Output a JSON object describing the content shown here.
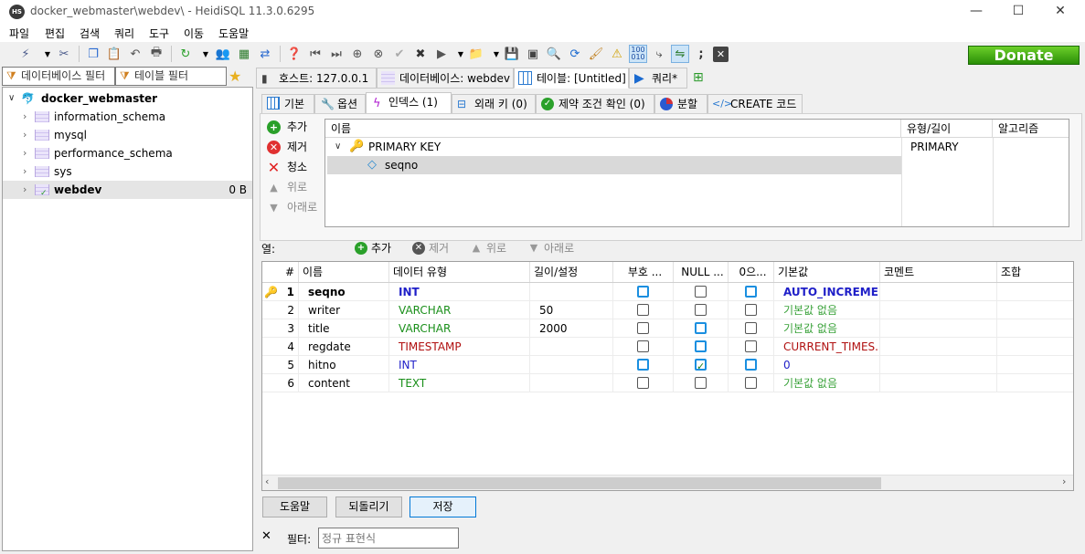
{
  "window": {
    "title": "docker_webmaster\\webdev\\ - HeidiSQL 11.3.0.6295",
    "app_icon_text": "HS",
    "controls": {
      "minimize": "—",
      "maximize": "☐",
      "close": "✕"
    }
  },
  "menu": [
    "파일",
    "편집",
    "검색",
    "쿼리",
    "도구",
    "이동",
    "도움말"
  ],
  "donate_label": "Donate",
  "filters": {
    "database": "데이터베이스 필터",
    "table": "테이블 필터"
  },
  "tree": {
    "root": "docker_webmaster",
    "items": [
      {
        "name": "information_schema",
        "size": ""
      },
      {
        "name": "mysql",
        "size": ""
      },
      {
        "name": "performance_schema",
        "size": ""
      },
      {
        "name": "sys",
        "size": ""
      },
      {
        "name": "webdev",
        "size": "0 B"
      }
    ]
  },
  "main_tabs": [
    {
      "label": "호스트: 127.0.0.1"
    },
    {
      "label": "데이터베이스: webdev"
    },
    {
      "label": "테이블: [Untitled]"
    },
    {
      "label": "쿼리*"
    }
  ],
  "sub_tabs": [
    {
      "label": "기본"
    },
    {
      "label": "옵션"
    },
    {
      "label": "인덱스 (1)"
    },
    {
      "label": "외래 키 (0)"
    },
    {
      "label": "제약 조건 확인 (0)"
    },
    {
      "label": "분할"
    },
    {
      "label": "CREATE 코드"
    }
  ],
  "index_actions": {
    "add": "추가",
    "remove": "제거",
    "clear": "청소",
    "up": "위로",
    "down": "아래로"
  },
  "index_grid": {
    "headers": {
      "name": "이름",
      "type": "유형/길이",
      "algorithm": "알고리즘"
    },
    "primary_key": {
      "name": "PRIMARY KEY",
      "type": "PRIMARY"
    },
    "column": "seqno"
  },
  "columns_toolbar": {
    "label": "열:",
    "add": "추가",
    "remove": "제거",
    "up": "위로",
    "down": "아래로"
  },
  "columns_grid": {
    "headers": [
      "#",
      "이름",
      "데이터 유형",
      "길이/설정",
      "부호 ...",
      "NULL ...",
      "0으...",
      "기본값",
      "코멘트",
      "조합"
    ],
    "rows": [
      {
        "num": "1",
        "name": "seqno",
        "type": "INT",
        "length": "",
        "unsigned": false,
        "null": false,
        "zerofill": false,
        "default": "AUTO_INCREME...",
        "default_color": "#1f1fc8",
        "type_color": "#1f1fc8",
        "bold": true,
        "pk": true
      },
      {
        "num": "2",
        "name": "writer",
        "type": "VARCHAR",
        "length": "50",
        "unsigned": false,
        "null": false,
        "zerofill": false,
        "default": "기본값 없음",
        "default_color": "#3aa23a",
        "type_color": "#1a8f1a",
        "bold": false,
        "pk": false
      },
      {
        "num": "3",
        "name": "title",
        "type": "VARCHAR",
        "length": "2000",
        "unsigned": false,
        "null": false,
        "zerofill": false,
        "default": "기본값 없음",
        "default_color": "#3aa23a",
        "type_color": "#1a8f1a",
        "bold": false,
        "pk": false
      },
      {
        "num": "4",
        "name": "regdate",
        "type": "TIMESTAMP",
        "length": "",
        "unsigned": false,
        "null": false,
        "zerofill": false,
        "default": "CURRENT_TIMES...",
        "default_color": "#b01010",
        "type_color": "#b01010",
        "bold": false,
        "pk": false
      },
      {
        "num": "5",
        "name": "hitno",
        "type": "INT",
        "length": "",
        "unsigned": false,
        "null": true,
        "zerofill": false,
        "default": "0",
        "default_color": "#1f1fc8",
        "type_color": "#1f1fc8",
        "bold": false,
        "pk": false
      },
      {
        "num": "6",
        "name": "content",
        "type": "TEXT",
        "length": "",
        "unsigned": false,
        "null": false,
        "zerofill": false,
        "default": "기본값 없음",
        "default_color": "#3aa23a",
        "type_color": "#1a8f1a",
        "bold": false,
        "pk": false
      }
    ]
  },
  "bottom_buttons": {
    "help": "도움말",
    "revert": "되돌리기",
    "save": "저장"
  },
  "filter_bar": {
    "close": "✕",
    "label": "필터:",
    "placeholder": "정규 표현식"
  }
}
